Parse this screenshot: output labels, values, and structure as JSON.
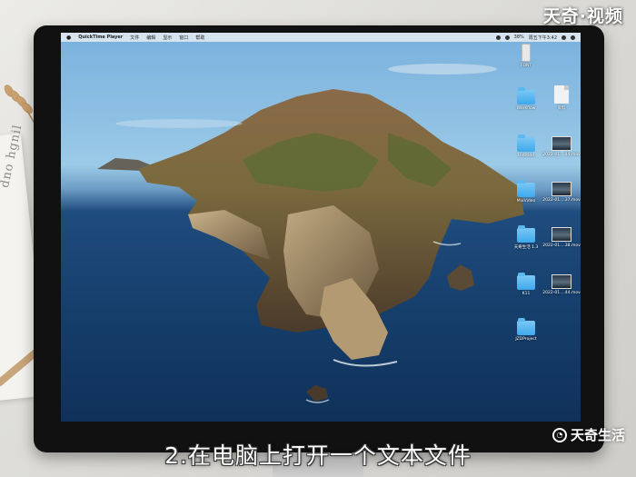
{
  "watermark": "天奇·视频",
  "brand_logo": "天奇生活",
  "caption": "2.在电脑上打开一个文本文件",
  "background": {
    "book_text": "dno hgnil"
  },
  "menubar": {
    "apple_icon": "apple-icon",
    "app_name": "QuickTime Player",
    "items": [
      "文件",
      "编辑",
      "显示",
      "窗口",
      "帮助"
    ],
    "battery": "38%",
    "clock": "周五下午3:42"
  },
  "desktop_icons": [
    {
      "type": "usb",
      "label": "FONT"
    },
    {
      "type": "folder",
      "label": "Workflow"
    },
    {
      "type": "doc",
      "label": "资料"
    },
    {
      "type": "folder",
      "label": "Untitled"
    },
    {
      "type": "video",
      "label": "2022-01....44.mov"
    },
    {
      "type": "folder",
      "label": "MixVideo"
    },
    {
      "type": "video",
      "label": "2022-01....37.mov"
    },
    {
      "type": "folder",
      "label": "天奇生活 1.3"
    },
    {
      "type": "video",
      "label": "2022-01....38.mov"
    },
    {
      "type": "folder",
      "label": "K11"
    },
    {
      "type": "video",
      "label": "2022-01....44.mov"
    },
    {
      "type": "folder",
      "label": "JZDProject"
    }
  ]
}
